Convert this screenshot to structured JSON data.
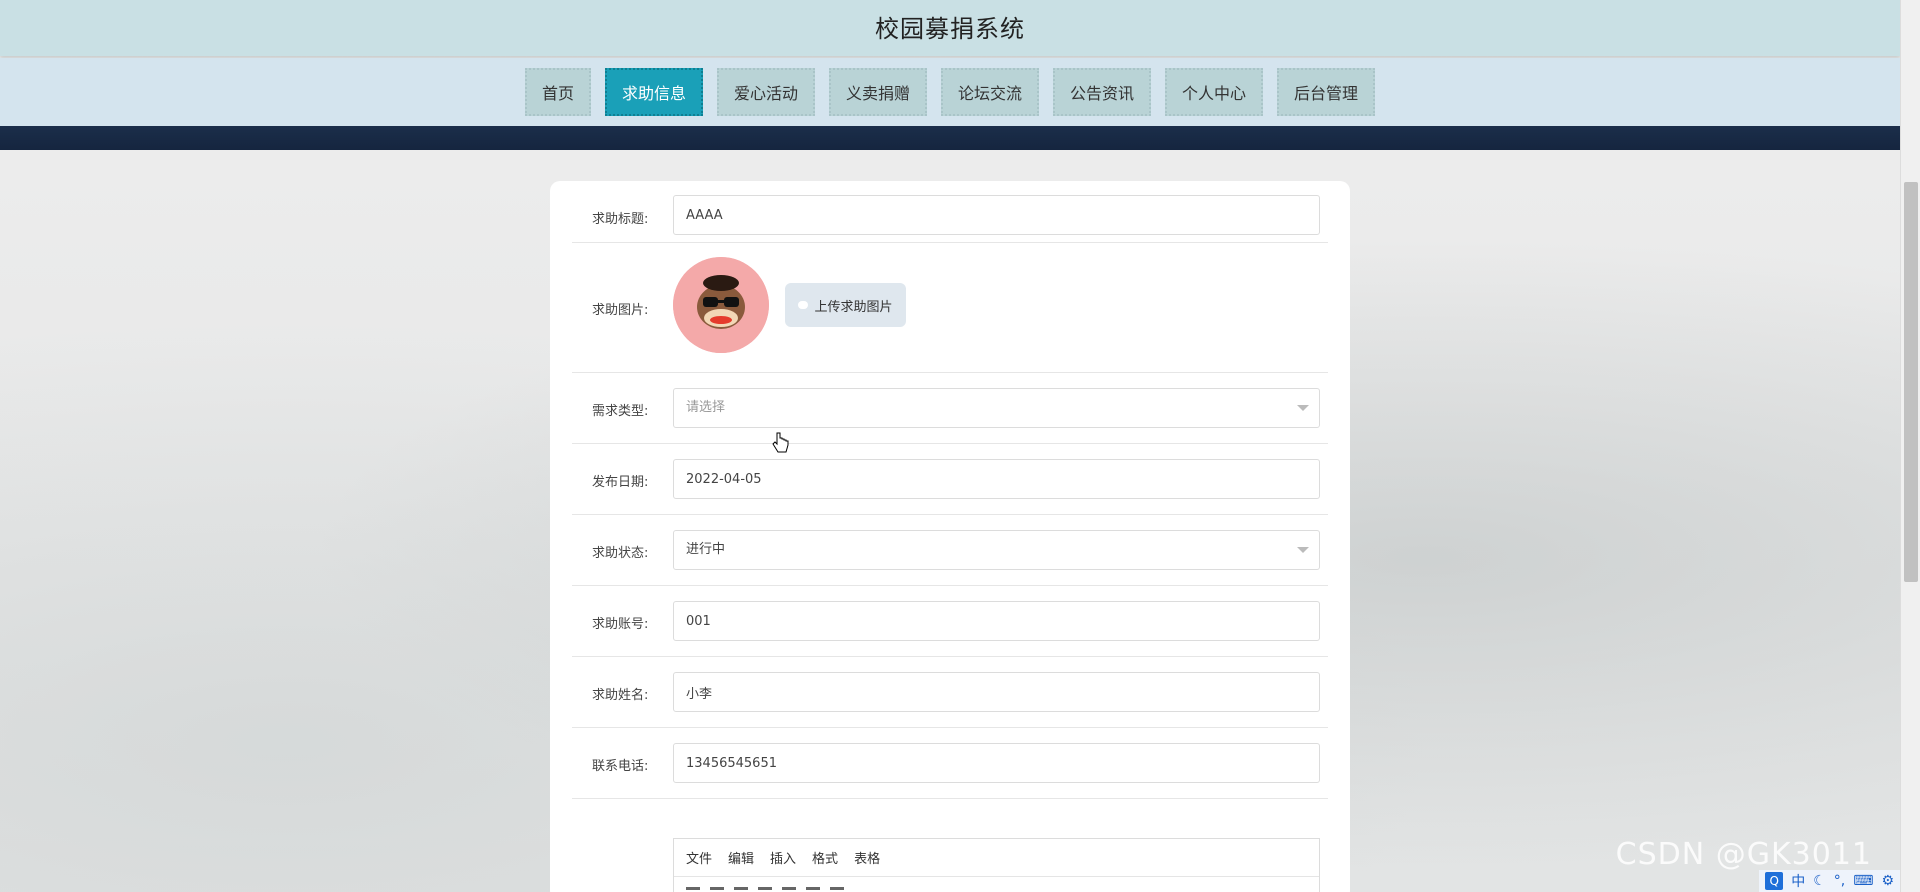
{
  "app": {
    "title": "校园募捐系统"
  },
  "nav": {
    "tabs": [
      {
        "label": "首页",
        "active": false
      },
      {
        "label": "求助信息",
        "active": true
      },
      {
        "label": "爱心活动",
        "active": false
      },
      {
        "label": "义卖捐赠",
        "active": false
      },
      {
        "label": "论坛交流",
        "active": false
      },
      {
        "label": "公告资讯",
        "active": false
      },
      {
        "label": "个人中心",
        "active": false
      },
      {
        "label": "后台管理",
        "active": false
      }
    ]
  },
  "form": {
    "title": {
      "label": "求助标题:",
      "value": "AAAA"
    },
    "image": {
      "label": "求助图片:",
      "upload_label": "上传求助图片"
    },
    "demand_type": {
      "label": "需求类型:",
      "placeholder": "请选择"
    },
    "publish_date": {
      "label": "发布日期:",
      "value": "2022-04-05"
    },
    "status": {
      "label": "求助状态:",
      "value": "进行中"
    },
    "account": {
      "label": "求助账号:",
      "value": "001"
    },
    "name": {
      "label": "求助姓名:",
      "value": "小李"
    },
    "phone": {
      "label": "联系电话:",
      "value": "13456545651"
    },
    "editor_menu": [
      "文件",
      "编辑",
      "插入",
      "格式",
      "表格"
    ]
  },
  "watermark": "CSDN @GK3011",
  "tray": {
    "ime": "中"
  },
  "colors": {
    "active_tab": "#1aa0b8",
    "header_bg": "#c9e0e4",
    "nav_bg": "#d4e4ee",
    "navy_band": "#1b2e4a"
  }
}
